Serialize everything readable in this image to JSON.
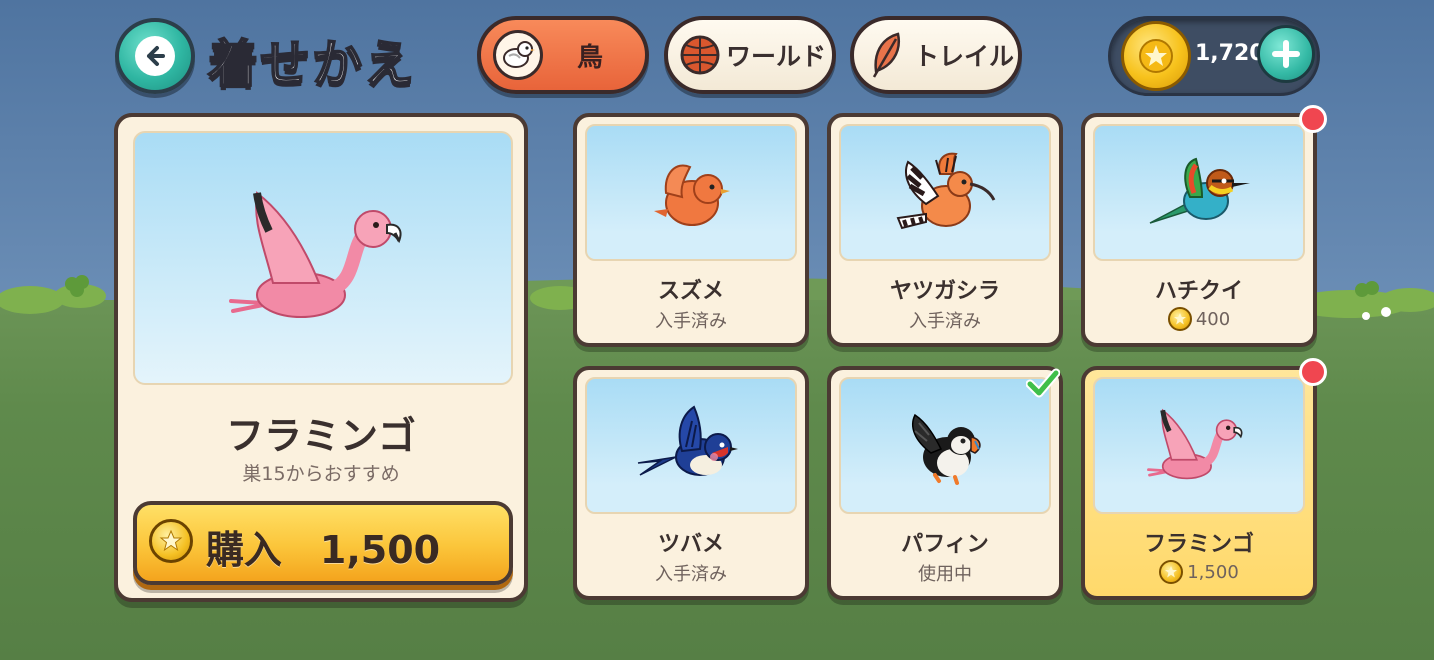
{
  "header": {
    "title": "着せかえ",
    "tabs": [
      {
        "label": "鳥",
        "icon": "bird-icon",
        "active": true
      },
      {
        "label": "ワールド",
        "icon": "globe-icon",
        "active": false
      },
      {
        "label": "トレイル",
        "icon": "feather-icon",
        "active": false
      }
    ],
    "coins": "1,720"
  },
  "preview": {
    "name": "フラミンゴ",
    "subtitle": "巣15からおすすめ",
    "buy_label": "購入　1,500"
  },
  "items": [
    {
      "name": "スズメ",
      "status": "入手済み",
      "has_coin": false,
      "bird": "sparrow"
    },
    {
      "name": "ヤツガシラ",
      "status": "入手済み",
      "has_coin": false,
      "bird": "hoopoe"
    },
    {
      "name": "ハチクイ",
      "status": "400",
      "has_coin": true,
      "bird": "bee-eater",
      "new": true
    },
    {
      "name": "ツバメ",
      "status": "入手済み",
      "has_coin": false,
      "bird": "swallow"
    },
    {
      "name": "パフィン",
      "status": "使用中",
      "has_coin": false,
      "bird": "puffin",
      "equipped": true
    },
    {
      "name": "フラミンゴ",
      "status": "1,500",
      "has_coin": true,
      "bird": "flamingo",
      "new": true,
      "selected": true
    }
  ],
  "colors": {
    "accent_tab": "#e8643a",
    "teal_button": "#2fb6a2",
    "buy_button": "#fbc53a",
    "new_badge": "#f04650",
    "equipped_check": "#3fbf4a"
  }
}
